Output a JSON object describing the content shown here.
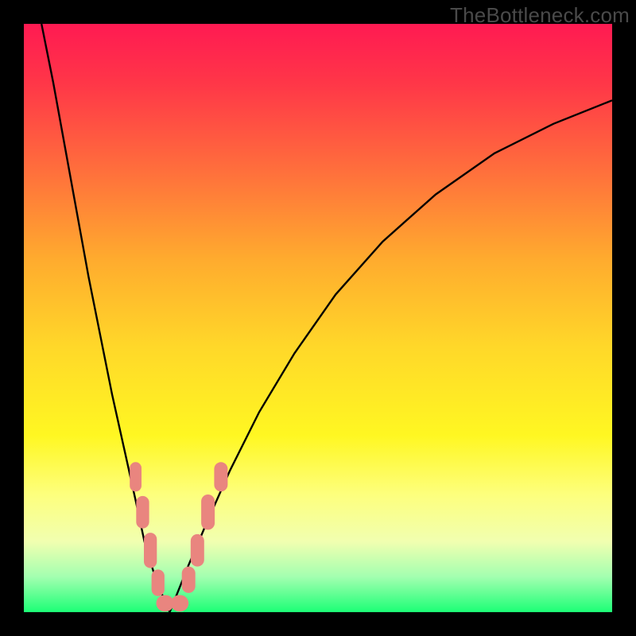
{
  "watermark": "TheBottleneck.com",
  "colors": {
    "frame": "#000000",
    "curve": "#000000",
    "dots": "#e9857f",
    "gradient_stops": [
      {
        "pct": 0,
        "hex": "#ff1a52"
      },
      {
        "pct": 10,
        "hex": "#ff3648"
      },
      {
        "pct": 25,
        "hex": "#ff6f3c"
      },
      {
        "pct": 40,
        "hex": "#ffab2e"
      },
      {
        "pct": 55,
        "hex": "#ffd829"
      },
      {
        "pct": 70,
        "hex": "#fff722"
      },
      {
        "pct": 80,
        "hex": "#fdff7d"
      },
      {
        "pct": 88,
        "hex": "#f1ffb0"
      },
      {
        "pct": 94,
        "hex": "#a3ffb0"
      },
      {
        "pct": 100,
        "hex": "#1cff76"
      }
    ]
  },
  "chart_data": {
    "type": "line",
    "title": "",
    "xlabel": "",
    "ylabel": "",
    "xlim": [
      0,
      100
    ],
    "ylim": [
      0,
      100
    ],
    "series": [
      {
        "name": "left-branch",
        "x": [
          3,
          5,
          7,
          9,
          11,
          13,
          15,
          17,
          19,
          20.5,
          22,
          23.5,
          24.8
        ],
        "y": [
          100,
          90,
          79,
          68,
          57,
          47,
          37,
          28,
          19,
          12,
          7,
          3,
          0
        ]
      },
      {
        "name": "right-branch",
        "x": [
          24.8,
          26,
          28,
          31,
          35,
          40,
          46,
          53,
          61,
          70,
          80,
          90,
          100
        ],
        "y": [
          0,
          3,
          8,
          15,
          24,
          34,
          44,
          54,
          63,
          71,
          78,
          83,
          87
        ]
      }
    ],
    "markers": [
      {
        "x": 19.0,
        "y": 23.0,
        "w": 2.0,
        "h": 5.0
      },
      {
        "x": 20.2,
        "y": 17.0,
        "w": 2.2,
        "h": 5.5
      },
      {
        "x": 21.5,
        "y": 10.5,
        "w": 2.2,
        "h": 6.0
      },
      {
        "x": 22.8,
        "y": 5.0,
        "w": 2.2,
        "h": 4.5
      },
      {
        "x": 24.0,
        "y": 1.5,
        "w": 3.0,
        "h": 2.8
      },
      {
        "x": 26.5,
        "y": 1.5,
        "w": 3.0,
        "h": 2.8
      },
      {
        "x": 28.0,
        "y": 5.5,
        "w": 2.3,
        "h": 4.5
      },
      {
        "x": 29.5,
        "y": 10.5,
        "w": 2.3,
        "h": 5.5
      },
      {
        "x": 31.3,
        "y": 17.0,
        "w": 2.3,
        "h": 6.0
      },
      {
        "x": 33.5,
        "y": 23.0,
        "w": 2.3,
        "h": 5.0
      }
    ]
  }
}
